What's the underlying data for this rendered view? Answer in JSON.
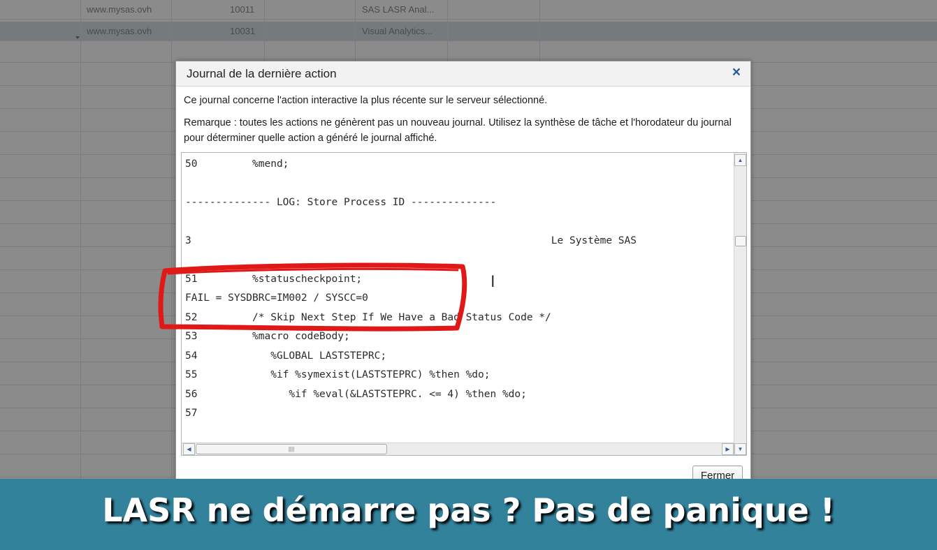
{
  "background_table": {
    "rows": [
      {
        "host": "www.mysas.ovh",
        "port": "10011",
        "product": "SAS LASR Anal..."
      },
      {
        "host": "www.mysas.ovh",
        "port": "10031",
        "product": "Visual Analytics..."
      }
    ]
  },
  "dialog": {
    "title": "Journal de la dernière action",
    "intro": "Ce journal concerne l'action interactive la plus récente sur le serveur sélectionné.",
    "note": "Remarque : toutes les actions ne génèrent pas un nouveau journal. Utilisez la synthèse de tâche et l'horodateur du journal pour déterminer quelle action a généré le journal affiché.",
    "log_lines": [
      "50         %mend;",
      "",
      "-------------- LOG: Store Process ID --------------",
      "",
      "3                                                           Le Système SAS",
      "",
      "51         %statuscheckpoint;",
      "FAIL = SYSDBRC=IM002 / SYSCC=0",
      "52         /* Skip Next Step If We Have a Bad Status Code */",
      "53         %macro codeBody;",
      "54            %GLOBAL LASTSTEPRC;",
      "55            %if %symexist(LASTSTEPRC) %then %do;",
      "56               %if %eval(&LASTSTEPRC. <= 4) %then %do;",
      "57"
    ],
    "close_button": "Fermer"
  },
  "banner": {
    "text": "LASR ne démarre pas ? Pas de panique !"
  },
  "colors": {
    "banner_bg": "#32829c",
    "highlight": "#e01818",
    "close_icon": "#2a5b9c"
  },
  "icons": [
    "close-icon",
    "scroll-up-icon",
    "scroll-down-icon",
    "scroll-left-icon",
    "scroll-right-icon",
    "text-cursor-icon"
  ]
}
